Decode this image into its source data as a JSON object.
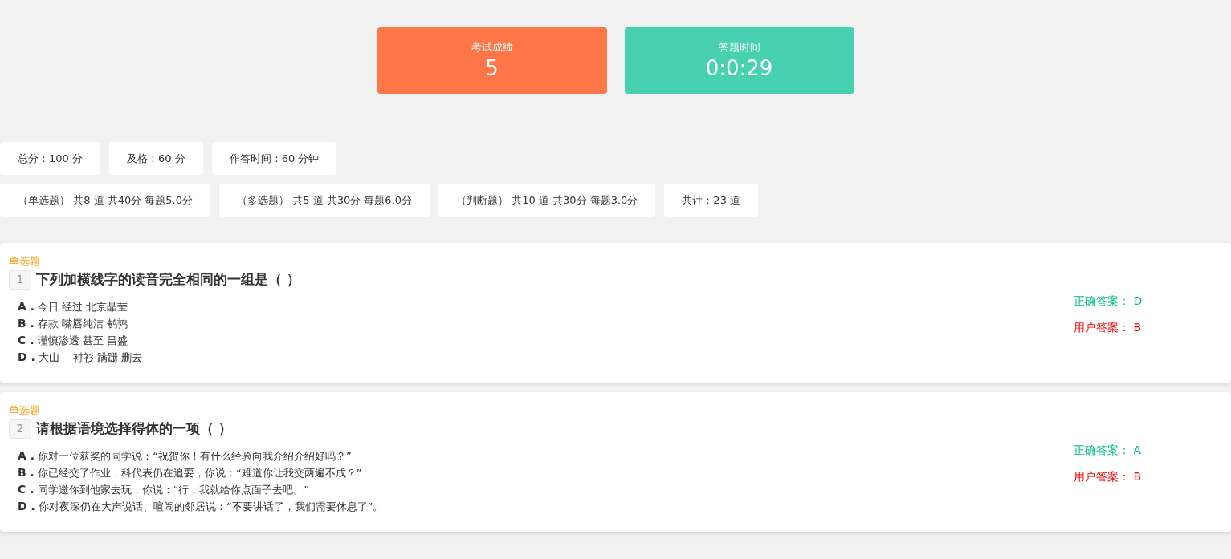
{
  "summary_cards": [
    {
      "label": "考试成绩",
      "value": "5",
      "color": "#ff7648"
    },
    {
      "label": "答题时间",
      "value": "0:0:29",
      "color": "#48d1b0"
    }
  ],
  "exam_info": [
    "总分：100 分",
    "及格：60 分",
    "作答时间：60 分钟"
  ],
  "section_info": [
    "（单选题） 共8 道 共40分 每题5.0分",
    "（多选题） 共5 道 共30分 每题6.0分",
    "（判断题） 共10 道 共30分 每题3.0分",
    "共计：23 道"
  ],
  "questions": [
    {
      "type": "单选题",
      "number": "1",
      "title": "下列加横线字的读音完全相同的一组是（ ）",
      "options": [
        {
          "letter": "A .",
          "text": "今日 经过 北京晶莹"
        },
        {
          "letter": "B .",
          "text": "存款 嘴唇纯洁 鹌鹑"
        },
        {
          "letter": "C .",
          "text": "谨慎渗透 甚至 昌盛"
        },
        {
          "letter": "D .",
          "text": "大山　 衬衫 蹒跚 删去"
        }
      ],
      "correct_label": "正确答案：",
      "correct": "D",
      "user_label": "用户答案：",
      "user": "B"
    },
    {
      "type": "单选题",
      "number": "2",
      "title": "请根据语境选择得体的一项（ ）",
      "options": [
        {
          "letter": "A .",
          "text": "你对一位获奖的同学说：“祝贺你！有什么经验向我介绍介绍好吗？”"
        },
        {
          "letter": "B .",
          "text": "你已经交了作业，科代表仍在追要，你说：“难道你让我交两遍不成？”"
        },
        {
          "letter": "C .",
          "text": "同学邀你到他家去玩，你说：“行，我就给你点面子去吧。”"
        },
        {
          "letter": "D .",
          "text": "你对夜深仍在大声说话、喧闹的邻居说：“不要讲话了，我们需要休息了”。"
        }
      ],
      "correct_label": "正确答案：",
      "correct": "A",
      "user_label": "用户答案：",
      "user": "B"
    }
  ]
}
